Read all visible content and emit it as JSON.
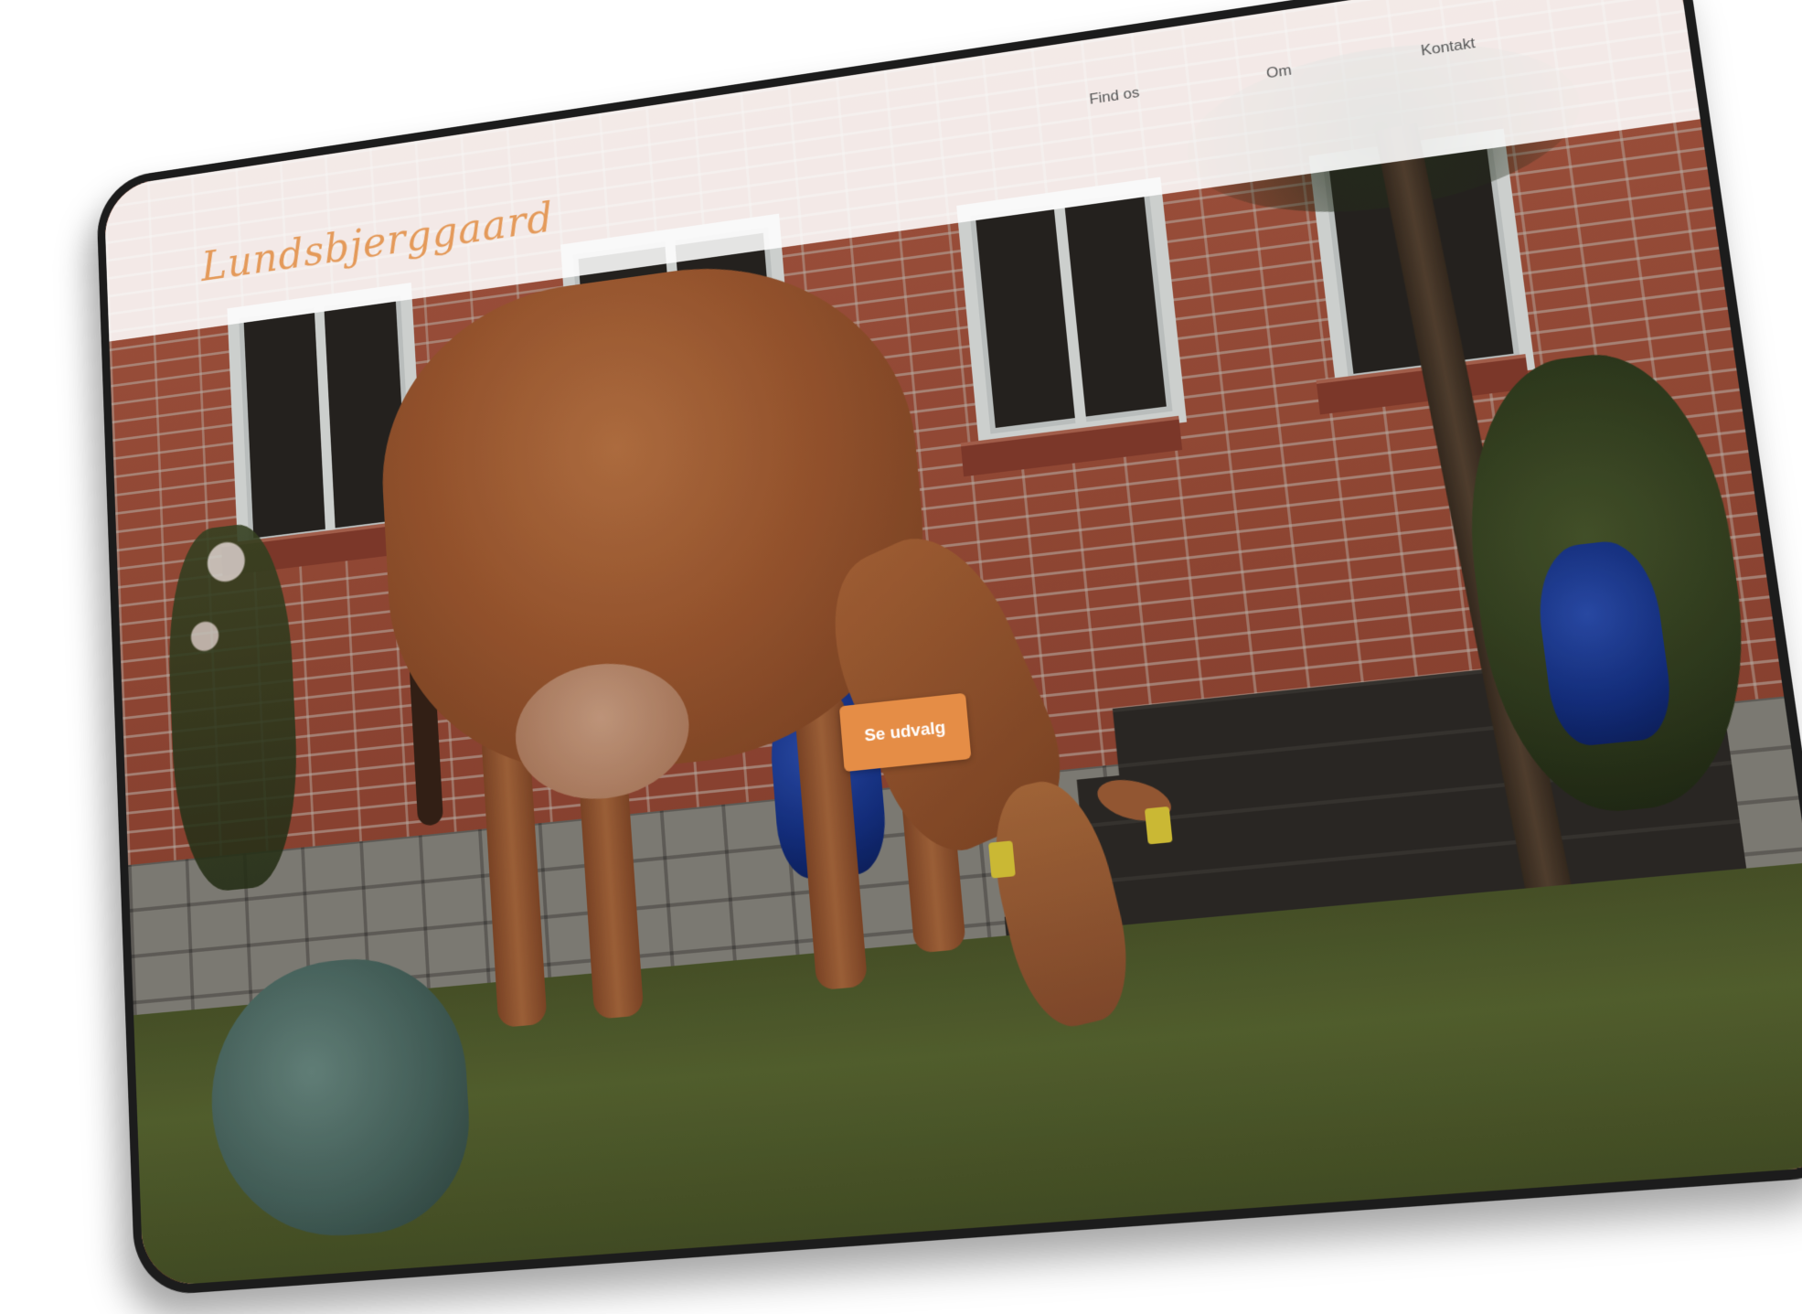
{
  "site": {
    "logo_text": "Lundsbjerggaard"
  },
  "nav": {
    "items": [
      {
        "label": "Find os"
      },
      {
        "label": "Om"
      },
      {
        "label": "Kontakt"
      }
    ]
  },
  "hero": {
    "cta_label": "Se udvalg",
    "image_subject": "cow-grazing-in-front-of-brick-farmhouse"
  },
  "colors": {
    "accent": "#e58d46",
    "logo": "#e49a5a",
    "header_bg": "#ffffff",
    "nav_text": "#555555"
  }
}
